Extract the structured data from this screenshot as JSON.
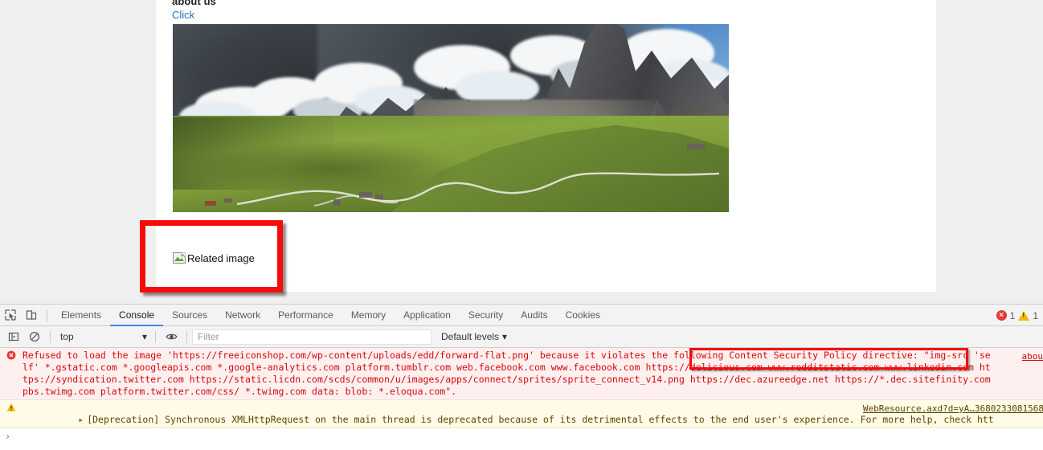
{
  "page": {
    "heading": "about us",
    "link_label": "Click",
    "hero_alt": "mountain landscape photo",
    "broken_image_alt": "Related image"
  },
  "devtools": {
    "tabs": [
      {
        "label": "Elements",
        "active": false
      },
      {
        "label": "Console",
        "active": true
      },
      {
        "label": "Sources",
        "active": false
      },
      {
        "label": "Network",
        "active": false
      },
      {
        "label": "Performance",
        "active": false
      },
      {
        "label": "Memory",
        "active": false
      },
      {
        "label": "Application",
        "active": false
      },
      {
        "label": "Security",
        "active": false
      },
      {
        "label": "Audits",
        "active": false
      },
      {
        "label": "Cookies",
        "active": false
      }
    ],
    "icons": {
      "inspect": "inspect-element-icon",
      "device": "device-toolbar-icon",
      "sidebar": "console-sidebar-icon",
      "clear": "clear-console-icon",
      "eye": "live-expression-icon"
    },
    "counts": {
      "errors": "1",
      "warnings": "1"
    },
    "toolbar": {
      "context_value": "top",
      "filter_placeholder": "Filter",
      "filter_value": "",
      "levels_label": "Default levels",
      "chevron": "▾"
    },
    "messages": [
      {
        "level": "error",
        "icon": "error-circle-icon",
        "text": "Refused to load the image 'https://freeiconshop.com/wp-content/uploads/edd/forward-flat.png' because it violates the following Content Security Policy directive: \"img-src 'self' *.gstatic.com *.googleapis.com *.google-analytics.com platform.tumblr.com web.facebook.com www.facebook.com https://delicious.com www.redditstatic.com www.linkedin.com https://syndication.twitter.com https://static.licdn.com/scds/common/u/images/apps/connect/sprites/sprite_connect_v14.png https://dec.azureedge.net https://*.dec.sitefinity.com pbs.twimg.com platform.twitter.com/css/ *.twimg.com data: blob: *.eloqua.com\".",
        "source": "abou"
      },
      {
        "level": "warn",
        "icon": "warning-triangle-icon",
        "disclosure": "▸",
        "text": "[Deprecation] Synchronous XMLHttpRequest on the main thread is deprecated because of its detrimental effects to the end user's experience. For more help, check https://xhr.spec.whatwg.org/.",
        "source": "WebResource.axd?d=yA…3680233081568"
      }
    ],
    "prompt": "›"
  },
  "annotations": [
    {
      "name": "broken-image-highlight",
      "color": "#f60b0b"
    },
    {
      "name": "csp-directive-highlight",
      "color": "#f60b0b"
    }
  ]
}
